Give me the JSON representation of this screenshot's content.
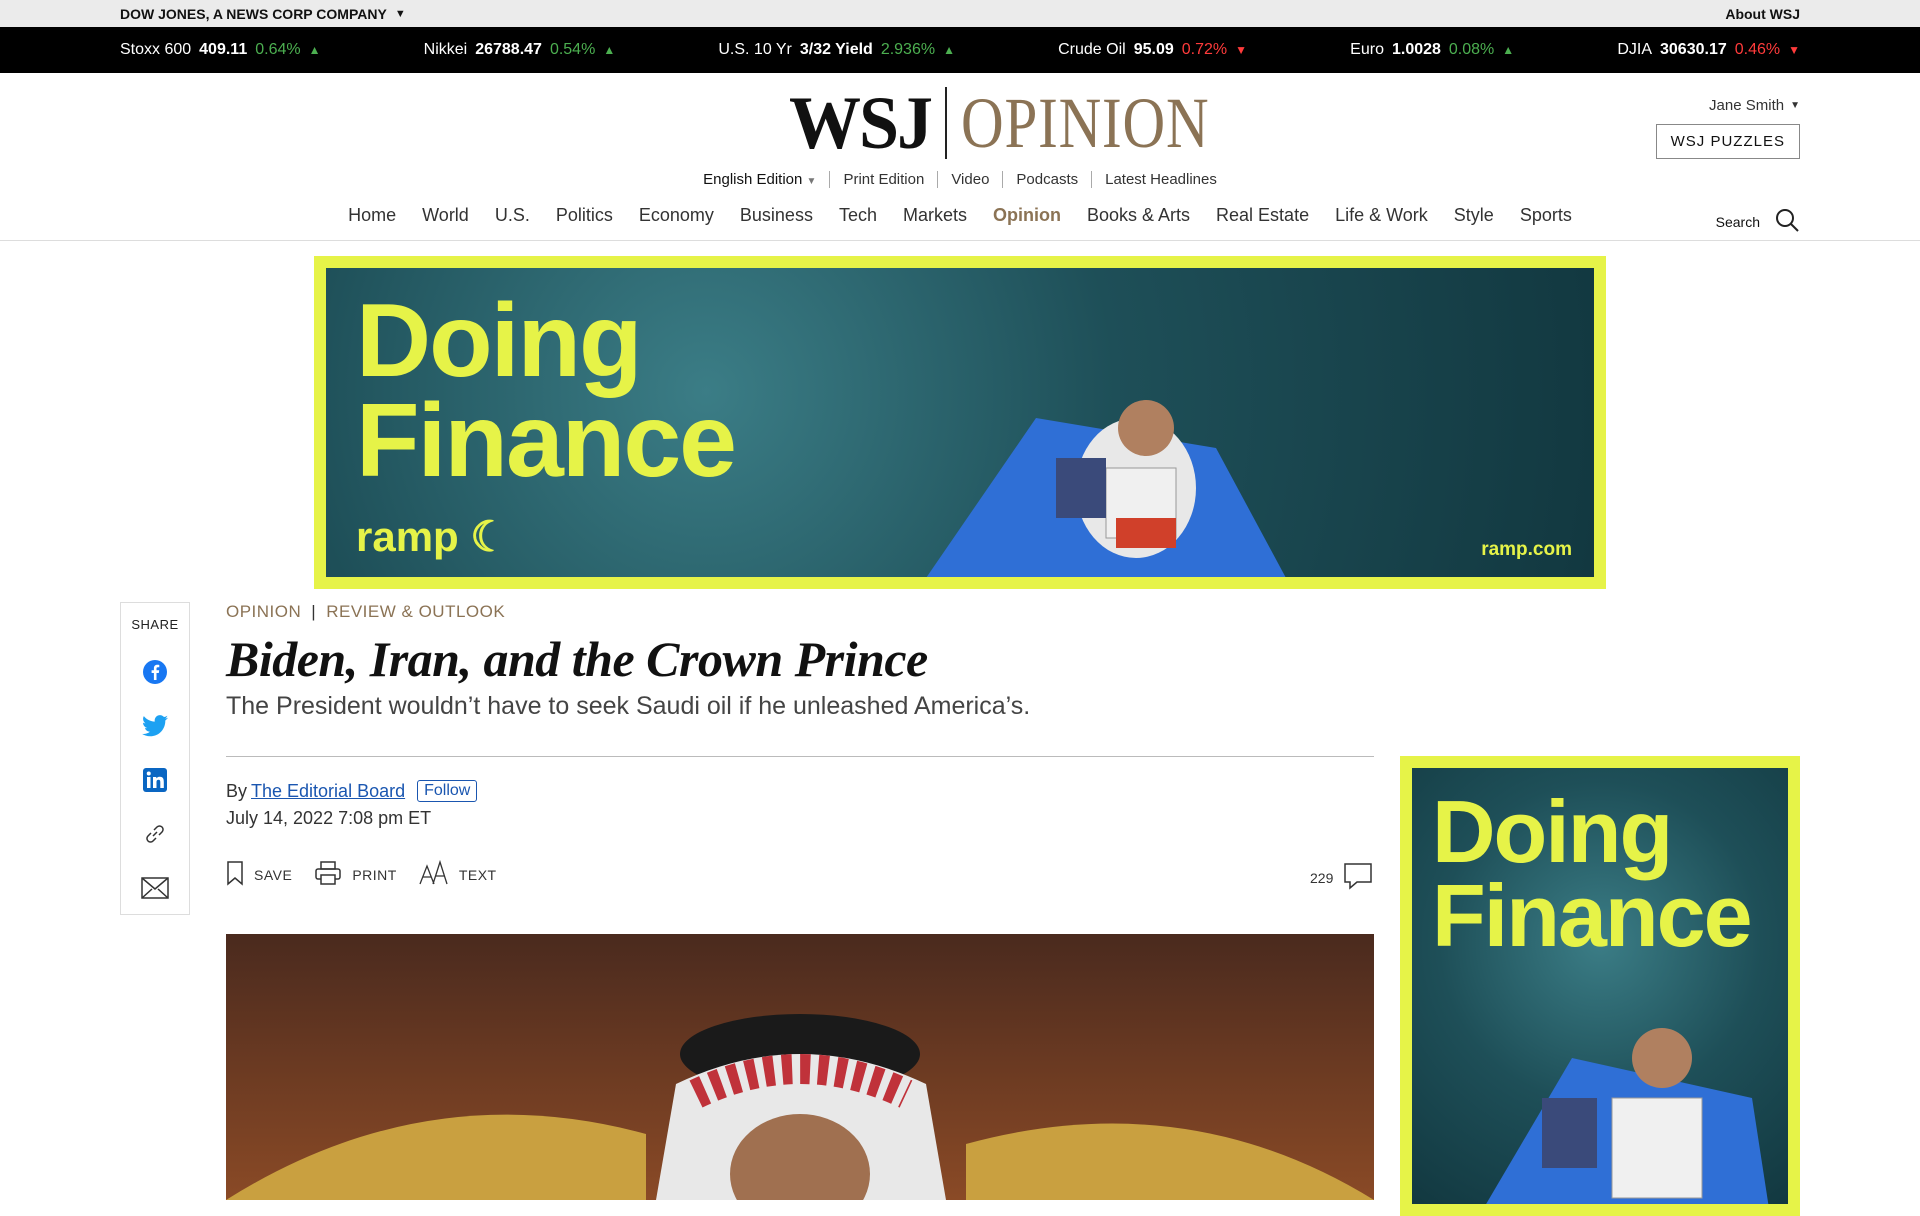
{
  "corp": {
    "company": "DOW JONES, A NEWS CORP COMPANY",
    "about": "About WSJ"
  },
  "ticker": [
    {
      "name": "Stoxx 600",
      "value": "409.11",
      "change": "0.64%",
      "dir": "up"
    },
    {
      "name": "Nikkei",
      "value": "26788.47",
      "change": "0.54%",
      "dir": "up"
    },
    {
      "name": "U.S. 10 Yr",
      "value": "3/32 Yield",
      "change": "2.936%",
      "dir": "up"
    },
    {
      "name": "Crude Oil",
      "value": "95.09",
      "change": "0.72%",
      "dir": "down"
    },
    {
      "name": "Euro",
      "value": "1.0028",
      "change": "0.08%",
      "dir": "up"
    },
    {
      "name": "DJIA",
      "value": "30630.17",
      "change": "0.46%",
      "dir": "down"
    }
  ],
  "masthead": {
    "logo_wsj": "WSJ",
    "logo_section": "OPINION",
    "user": "Jane Smith",
    "puzzles": "WSJ PUZZLES",
    "editions": [
      "English Edition",
      "Print Edition",
      "Video",
      "Podcasts",
      "Latest Headlines"
    ],
    "search_label": "Search"
  },
  "nav": [
    "Home",
    "World",
    "U.S.",
    "Politics",
    "Economy",
    "Business",
    "Tech",
    "Markets",
    "Opinion",
    "Books & Arts",
    "Real Estate",
    "Life & Work",
    "Style",
    "Sports"
  ],
  "nav_active": "Opinion",
  "ad": {
    "headline_1": "Doing",
    "headline_2": "Finance",
    "brand": "ramp",
    "url": "ramp.com"
  },
  "article": {
    "section": "OPINION",
    "subsection": "REVIEW & OUTLOOK",
    "headline": "Biden, Iran, and the Crown Prince",
    "dek": "The President wouldn’t have to seek Saudi oil if he unleashed America’s.",
    "by": "By",
    "author": "The Editorial Board",
    "follow": "Follow",
    "date": "July 14, 2022 7:08 pm ET",
    "tools": {
      "save": "SAVE",
      "print": "PRINT",
      "text": "TEXT"
    },
    "comment_count": "229"
  },
  "share": {
    "label": "SHARE"
  },
  "colors": {
    "accent": "#8b7355",
    "ad_yellow": "#e6f348",
    "up": "#4caf50",
    "down": "#ff3b3b"
  }
}
